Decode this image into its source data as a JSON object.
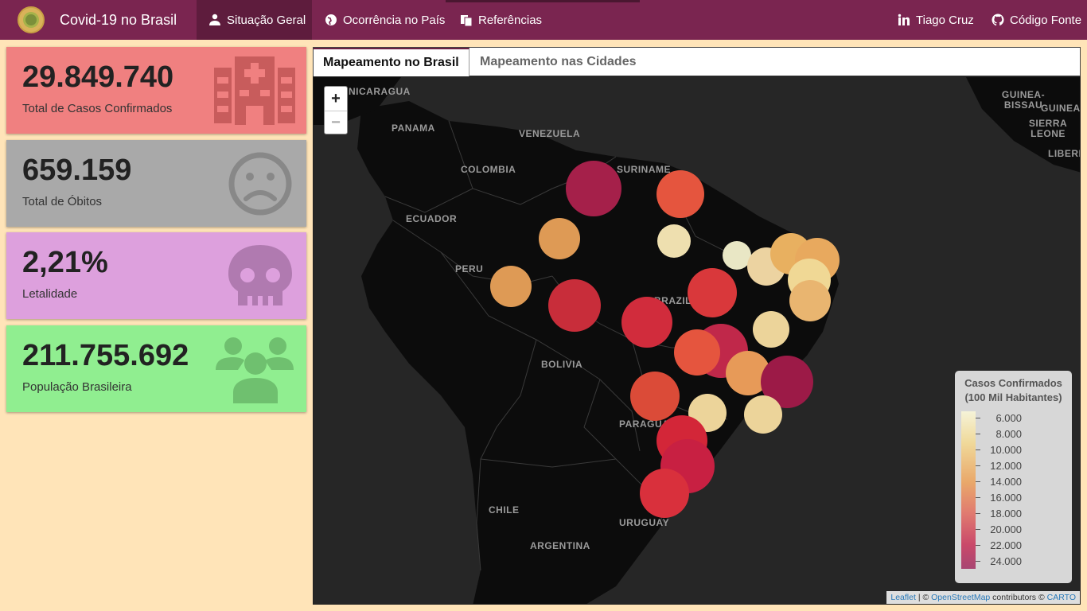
{
  "navbar": {
    "title": "Covid-19 no Brasil",
    "items": [
      {
        "label": "Situação Geral",
        "icon": "user-md-icon"
      },
      {
        "label": "Ocorrência no País",
        "icon": "globe-icon"
      },
      {
        "label": "Referências",
        "icon": "copy-icon"
      }
    ],
    "right": [
      {
        "label": "Tiago Cruz",
        "icon": "linkedin-icon"
      },
      {
        "label": "Código Fonte",
        "icon": "github-icon"
      }
    ]
  },
  "value_boxes": [
    {
      "value": "29.849.740",
      "label": "Total de Casos Confirmados",
      "color": "#f08080",
      "icon": "hospital-icon"
    },
    {
      "value": "659.159",
      "label": "Total de Óbitos",
      "color": "#a9a9a9",
      "icon": "sad-face-icon"
    },
    {
      "value": "2,21%",
      "label": "Letalidade",
      "color": "#dda0dd",
      "icon": "skull-icon"
    },
    {
      "value": "211.755.692",
      "label": "População Brasileira",
      "color": "#90ee90",
      "icon": "users-icon"
    }
  ],
  "tabs": [
    {
      "label": "Mapeamento no Brasil",
      "active": true
    },
    {
      "label": "Mapeamento nas Cidades",
      "active": false
    }
  ],
  "map": {
    "zoom_in": "+",
    "zoom_out": "−",
    "place_labels": [
      "NICARAGUA",
      "PANAMA",
      "VENEZUELA",
      "SURINAME",
      "COLOMBIA",
      "ECUADOR",
      "PERU",
      "BRAZIL",
      "BOLIVIA",
      "PARAGUAY",
      "CHILE",
      "URUGUAY",
      "ARGENTINA",
      "GUINEA-BISSAU",
      "GUINEA",
      "SIERRA LEONE",
      "LIBERIA"
    ],
    "legend": {
      "title_line1": "Casos Confirmados",
      "title_line2": "(100 Mil Habitantes)",
      "ticks": [
        "6.000",
        "8.000",
        "10.000",
        "12.000",
        "14.000",
        "16.000",
        "18.000",
        "20.000",
        "22.000",
        "24.000"
      ]
    },
    "attribution": {
      "leaflet": "Leaflet",
      "sep": " | © ",
      "osm": "OpenStreetMap",
      "contributors": " contributors © ",
      "carto": "CARTO"
    }
  }
}
